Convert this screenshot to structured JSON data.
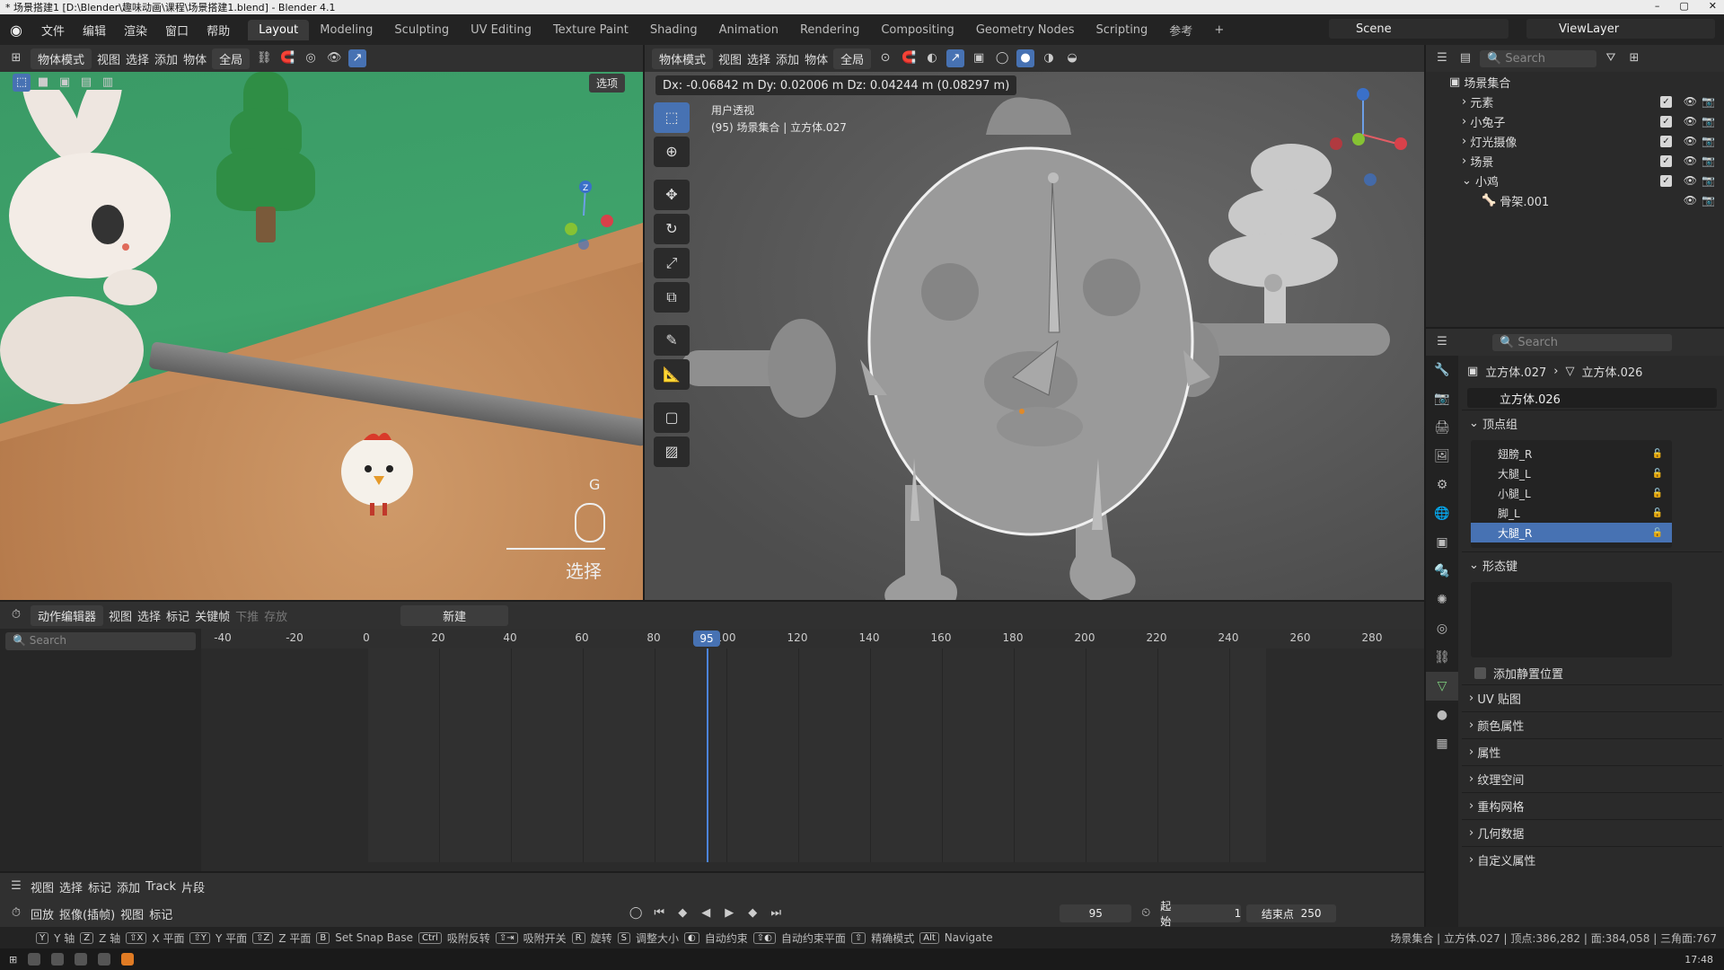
{
  "window": {
    "title": "* 场景搭建1 [D:\\Blender\\趣味动画\\课程\\场景搭建1.blend] - Blender 4.1"
  },
  "topbar": {
    "menus": [
      "文件",
      "编辑",
      "渲染",
      "窗口",
      "帮助"
    ],
    "workspaces": [
      "Layout",
      "Modeling",
      "Sculpting",
      "UV Editing",
      "Texture Paint",
      "Shading",
      "Animation",
      "Rendering",
      "Compositing",
      "Geometry Nodes",
      "Scripting",
      "参考"
    ],
    "active_workspace": "Layout",
    "scene": "Scene",
    "view_layer": "ViewLayer"
  },
  "left_viewport": {
    "mode": "物体模式",
    "menus": [
      "视图",
      "选择",
      "添加",
      "物体"
    ],
    "transform": "全局",
    "options_label": "选项",
    "hint_key": "G",
    "hint_label": "选择"
  },
  "right_viewport": {
    "mode": "物体模式",
    "menus": [
      "视图",
      "选择",
      "添加",
      "物体"
    ],
    "transform": "全局",
    "info": "Dx: -0.06842 m   Dy: 0.02006 m   Dz: 0.04244 m (0.08297 m)",
    "view_label": "用户透视",
    "object_label": "(95) 场景集合 | 立方体.027"
  },
  "outliner": {
    "search_placeholder": "Search",
    "rows": [
      {
        "label": "场景集合",
        "indent": 0,
        "checked": false
      },
      {
        "label": "元素",
        "indent": 1,
        "checked": true
      },
      {
        "label": "小兔子",
        "indent": 1,
        "checked": true
      },
      {
        "label": "灯光摄像",
        "indent": 1,
        "checked": true
      },
      {
        "label": "场景",
        "indent": 1,
        "checked": true
      },
      {
        "label": "小鸡",
        "indent": 1,
        "checked": true
      },
      {
        "label": "骨架.001",
        "indent": 2,
        "checked": false
      }
    ]
  },
  "properties": {
    "search_placeholder": "Search",
    "breadcrumb_object": "立方体.027",
    "breadcrumb_mesh": "立方体.026",
    "mesh_name": "立方体.026",
    "vertex_groups_title": "顶点组",
    "vertex_groups": [
      "翅膀_R",
      "大腿_L",
      "小腿_L",
      "脚_L",
      "大腿_R"
    ],
    "selected_vertex_group": "大腿_R",
    "shape_keys_title": "形态键",
    "rest_position_label": "添加静置位置",
    "sections": [
      "UV 贴图",
      "颜色属性",
      "属性",
      "纹理空间",
      "重构网格",
      "几何数据",
      "自定义属性"
    ]
  },
  "action_editor": {
    "editor_name": "动作编辑器",
    "menus": [
      "视图",
      "选择",
      "标记",
      "关键帧"
    ],
    "push_down": "下推",
    "stash": "存放",
    "new_label": "新建",
    "search_placeholder": "Search",
    "ruler_ticks": [
      "-40",
      "-20",
      "0",
      "20",
      "40",
      "60",
      "80",
      "100",
      "120",
      "140",
      "160",
      "180",
      "200",
      "220",
      "240",
      "260",
      "280"
    ],
    "current_frame": "95"
  },
  "nla": {
    "menus": [
      "视图",
      "选择",
      "标记",
      "添加",
      "Track",
      "片段"
    ]
  },
  "timeline": {
    "menus": [
      "回放",
      "抠像(插帧)",
      "视图",
      "标记"
    ],
    "frame": "95",
    "start_label": "起始",
    "start_value": "1",
    "end_label": "结束点",
    "end_value": "250"
  },
  "statusbar": {
    "items": [
      "X 轴",
      "Y 轴",
      "Z 轴",
      "X 平面",
      "Y 平面",
      "Z 平面",
      "Set Snap Base",
      "吸附反转",
      "吸附开关",
      "旋转",
      "调整大小",
      "自动约束",
      "自动约束平面",
      "精确模式",
      "Navigate"
    ],
    "stats": "场景集合 | 立方体.027 | 顶点:386,282 | 面:384,058 | 三角面:767",
    "clock": "17:48"
  }
}
